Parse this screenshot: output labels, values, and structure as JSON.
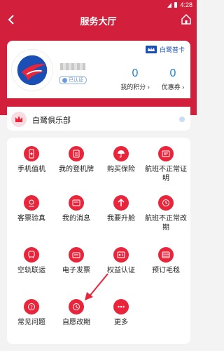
{
  "status": {
    "time": "4:28"
  },
  "header": {
    "title": "服务大厅"
  },
  "profile": {
    "vip_label": "白鹭普卡",
    "badge_label": "已认证",
    "points_value": "0",
    "points_label": "我的积分",
    "coupons_value": "0",
    "coupons_label": "优惠券"
  },
  "club": {
    "label": "白鹭俱乐部"
  },
  "services": [
    {
      "label": "手机值机",
      "icon": "phone-checkin-icon"
    },
    {
      "label": "我的登机牌",
      "icon": "boarding-pass-icon"
    },
    {
      "label": "购买保险",
      "icon": "umbrella-icon"
    },
    {
      "label": "航班不正常证明",
      "icon": "certificate-icon"
    },
    {
      "label": "客票验真",
      "icon": "ticket-verify-icon"
    },
    {
      "label": "我的消息",
      "icon": "message-icon"
    },
    {
      "label": "我要升舱",
      "icon": "upgrade-icon"
    },
    {
      "label": "航班不正常改期",
      "icon": "reschedule-icon"
    },
    {
      "label": "空轨联运",
      "icon": "train-icon"
    },
    {
      "label": "电子发票",
      "icon": "invoice-icon"
    },
    {
      "label": "权益认证",
      "icon": "id-card-icon"
    },
    {
      "label": "预订毛毯",
      "icon": "blanket-icon"
    },
    {
      "label": "常见问题",
      "icon": "question-icon"
    },
    {
      "label": "自愿改期",
      "icon": "voluntary-reschedule-icon"
    },
    {
      "label": "更多",
      "icon": "more-icon"
    }
  ],
  "colors": {
    "brand_red": "#d2203c",
    "icon_red": "#e8253b",
    "accent_blue": "#1f7fd0"
  }
}
